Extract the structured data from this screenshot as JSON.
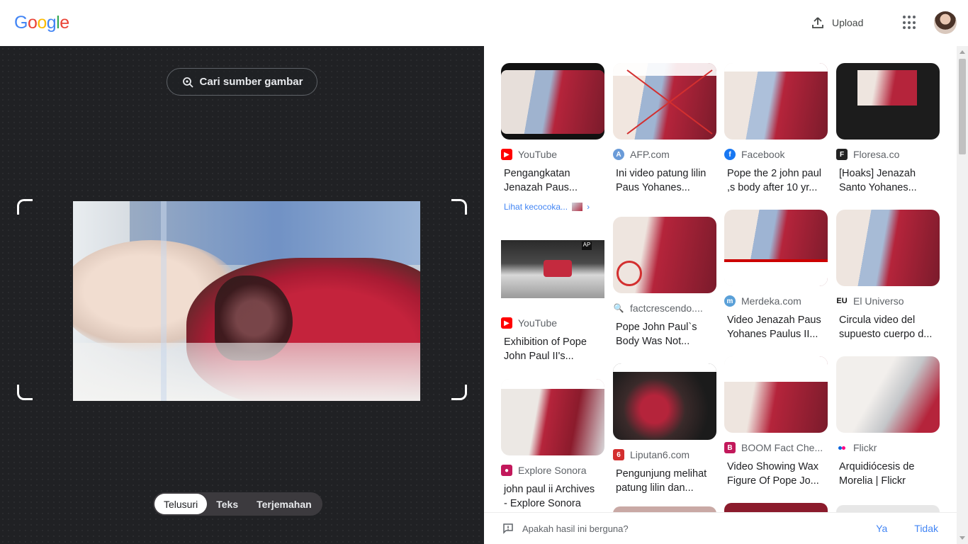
{
  "header": {
    "upload_label": "Upload"
  },
  "lens": {
    "find_source_label": "Cari sumber gambar",
    "modes": [
      "Telusuri",
      "Teks",
      "Terjemahan"
    ],
    "active_mode": "Telusuri"
  },
  "results": [
    {
      "source": "YouTube",
      "title1": "Pengangkatan",
      "title2": "Jenazah Paus...",
      "extra": "Lihat kecocoka..."
    },
    {
      "source": "AFP.com",
      "title1": "Ini video patung lilin",
      "title2": "Paus Yohanes..."
    },
    {
      "source": "Facebook",
      "title1": "Pope the 2 john paul",
      "title2": ",s body after 10 yr..."
    },
    {
      "source": "Floresa.co",
      "title1": "[Hoaks] Jenazah",
      "title2": "Santo Yohanes..."
    },
    {
      "source": "YouTube",
      "title1": "Exhibition of Pope",
      "title2": "John Paul II's..."
    },
    {
      "source": "factcrescendo....",
      "title1": "Pope John Paul`s",
      "title2": "Body Was Not..."
    },
    {
      "source": "Merdeka.com",
      "title1": "Video Jenazah Paus",
      "title2": "Yohanes Paulus II..."
    },
    {
      "source": "El Universo",
      "title1": "Circula video del",
      "title2": "supuesto cuerpo d..."
    },
    {
      "source": "Explore Sonora",
      "title1": "john paul ii Archives",
      "title2": "- Explore Sonora"
    },
    {
      "source": "Liputan6.com",
      "title1": "Pengunjung melihat",
      "title2": "patung lilin dan..."
    },
    {
      "source": "BOOM Fact Che...",
      "title1": "Video Showing Wax",
      "title2": "Figure Of Pope Jo..."
    },
    {
      "source": "Flickr",
      "title1": "Arquidiócesis de",
      "title2": "Morelia | Flickr"
    }
  ],
  "feedback": {
    "question": "Apakah hasil ini berguna?",
    "yes": "Ya",
    "no": "Tidak"
  },
  "colors": {
    "youtube": "#ff0000",
    "afp": "#6a9bd8",
    "facebook": "#1877f2",
    "floresa": "#222222",
    "merdeka": "#5aa0d8",
    "liputan6": "#d32f2f",
    "boom": "#c2185b",
    "explore_sonora": "#c2185b",
    "link_blue": "#4285f4"
  }
}
